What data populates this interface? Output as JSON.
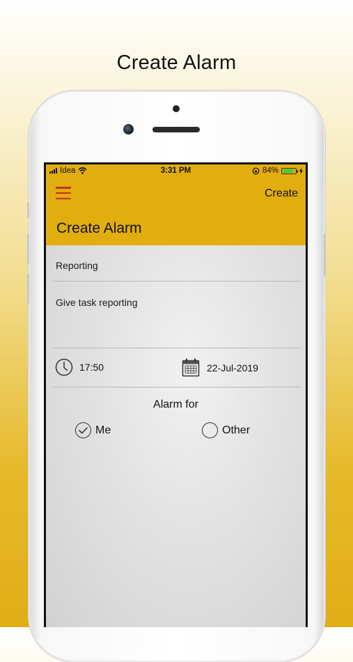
{
  "promo": {
    "title": "Create Alarm"
  },
  "status_bar": {
    "carrier": "Idea",
    "time": "3:31 PM",
    "battery": "84%",
    "battery_level": 0.84
  },
  "header": {
    "menu_icon": "hamburger-menu-icon",
    "action_label": "Create",
    "title": "Create Alarm"
  },
  "form": {
    "subject": "Reporting",
    "description": "Give task reporting",
    "time": "17:50",
    "date": "22-Jul-2019",
    "alarm_for_label": "Alarm for",
    "options": [
      {
        "label": "Me",
        "selected": true
      },
      {
        "label": "Other",
        "selected": false
      }
    ]
  },
  "colors": {
    "accent": "#e2ad0f",
    "menu_icon": "#c62f1c",
    "battery_fill": "#3ad23a"
  }
}
